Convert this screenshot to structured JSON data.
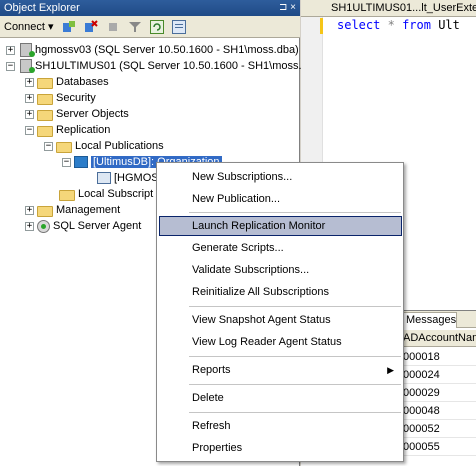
{
  "object_explorer": {
    "title": "Object Explorer",
    "pin_glyph": "⊐ ×",
    "connect_label": "Connect ▾",
    "toolbar_icons": [
      "connect-icon",
      "disconnect-icon",
      "stop-icon",
      "filter-icon",
      "refresh-icon",
      "summary-icon"
    ]
  },
  "tree": {
    "server1": "hgmossv03 (SQL Server 10.50.1600 - SH1\\moss.dba)",
    "server2": "SH1ULTIMUS01 (SQL Server 10.50.1600 - SH1\\moss.d",
    "databases": "Databases",
    "security": "Security",
    "server_objects": "Server Objects",
    "replication": "Replication",
    "local_publications": "Local Publications",
    "publication": "[UltimusDB]: Organization",
    "subscription": "[HGMOS",
    "local_subscriptions": "Local Subscript",
    "management": "Management",
    "sql_agent": "SQL Server Agent",
    "expand_plus": "+",
    "expand_minus": "−"
  },
  "editor": {
    "tab_label": "SH1ULTIMUS01...lt_UserExte",
    "code": {
      "select": "select",
      "star": "*",
      "from": "from",
      "rest": "Ult"
    }
  },
  "results": {
    "messages_tab": "Messages",
    "column_header": "ADAccountNam",
    "rows": [
      "000018",
      "000024",
      "000029",
      "000048",
      "000052",
      "000055"
    ]
  },
  "context_menu": {
    "items": [
      "New Subscriptions...",
      "New Publication...",
      "Launch Replication Monitor",
      "Generate Scripts...",
      "Validate Subscriptions...",
      "Reinitialize All Subscriptions",
      "View Snapshot Agent Status",
      "View Log Reader Agent Status",
      "Reports",
      "Delete",
      "Refresh",
      "Properties"
    ],
    "submenu_arrow": "▶"
  }
}
